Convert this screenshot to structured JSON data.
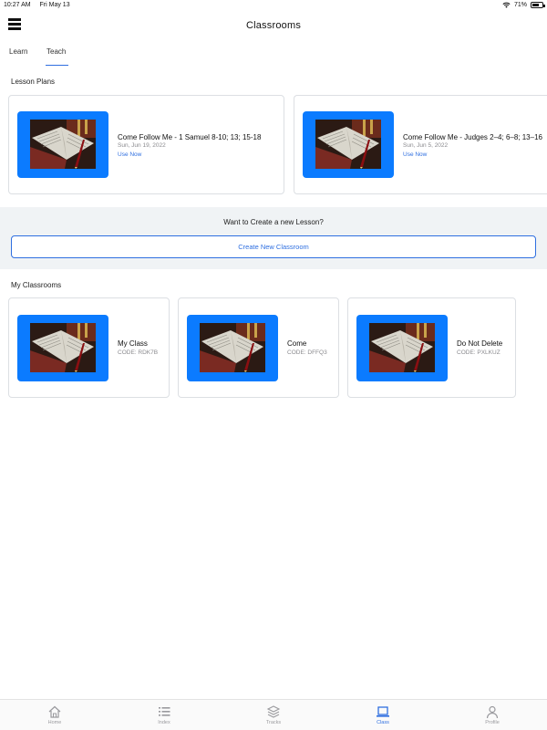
{
  "status_bar": {
    "time": "10:27 AM",
    "date": "Fri May 13",
    "battery": "71%",
    "battery_level": 0.71
  },
  "header": {
    "title": "Classrooms"
  },
  "tabs": [
    {
      "label": "Learn",
      "active": false
    },
    {
      "label": "Teach",
      "active": true
    }
  ],
  "lesson_plans": {
    "heading": "Lesson Plans",
    "items": [
      {
        "title": "Come Follow Me - 1 Samuel 8-10; 13; 15-18",
        "date": "Sun, Jun 19, 2022",
        "action": "Use Now"
      },
      {
        "title": "Come Follow Me  - Judges 2–4; 6–8; 13–16",
        "date": "Sun, Jun 5, 2022",
        "action": "Use Now"
      }
    ]
  },
  "create": {
    "prompt": "Want to Create a new Lesson?",
    "button_label": "Create New Classroom"
  },
  "my_classrooms": {
    "heading": "My Classrooms",
    "items": [
      {
        "name": "My Class",
        "code": "CODE: RDK7B"
      },
      {
        "name": "Come",
        "code": "CODE: DFFQ3"
      },
      {
        "name": "Do Not Delete",
        "code": "CODE: PXLKUZ"
      }
    ]
  },
  "bottom_tabs": [
    {
      "label": "Home",
      "icon": "home-icon",
      "active": false
    },
    {
      "label": "Index",
      "icon": "list-icon",
      "active": false
    },
    {
      "label": "Tracks",
      "icon": "layers-icon",
      "active": false
    },
    {
      "label": "Class",
      "icon": "laptop-icon",
      "active": true
    },
    {
      "label": "Profile",
      "icon": "person-icon",
      "active": false
    }
  ],
  "colors": {
    "accent": "#2f6fe0",
    "thumbnail_bg": "#0b7bff",
    "band_bg": "#f0f3f5"
  }
}
